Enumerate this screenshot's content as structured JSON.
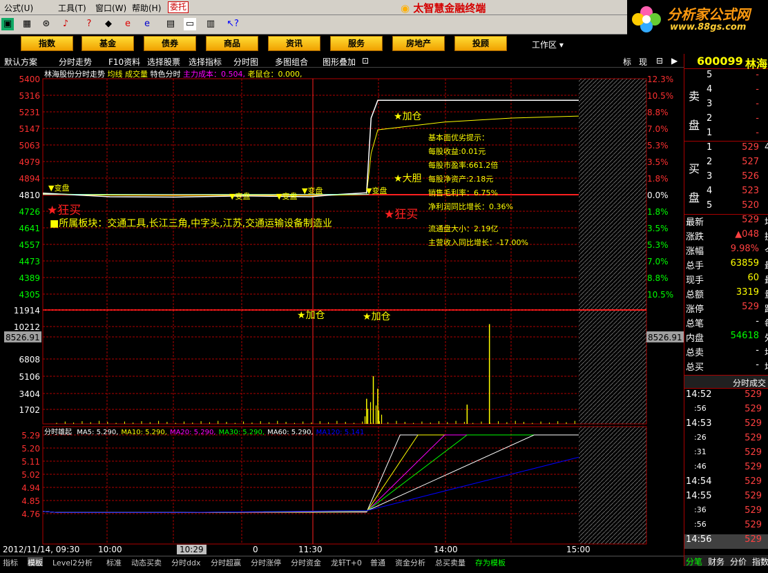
{
  "menu": {
    "items": [
      "公式(U)",
      "工具(T)",
      "窗口(W)",
      "帮助(H)"
    ],
    "entrust": "委托",
    "app_title": "太智慧金融终端"
  },
  "logo": {
    "name": "分析家公式网",
    "url": "www.88gs.com"
  },
  "nav": {
    "buttons": [
      "指数",
      "基金",
      "债券",
      "商品",
      "资讯",
      "服务",
      "房地产",
      "投顾"
    ],
    "workarea": "工作区"
  },
  "subbar": {
    "items": [
      "默认方案",
      "分时走势",
      "F10资料",
      "选择股票",
      "选择指标",
      "分时图",
      "多图组合",
      "图形叠加"
    ],
    "right": [
      "标",
      "现"
    ]
  },
  "stock": {
    "code": "600099",
    "name": "林海"
  },
  "chart_header": {
    "title": "林海股份分时走势",
    "avg": "均线",
    "vol": "成交量",
    "feature": "特色分时",
    "main_cost": "主力成本：0.504,",
    "old_pos": "老鼠仓：0.000,"
  },
  "price_axis": {
    "left": [
      "5400",
      "5316",
      "5231",
      "5147",
      "5063",
      "4979",
      "4894",
      "4810",
      "4726",
      "4641",
      "4557",
      "4473",
      "4389",
      "4305"
    ],
    "right": [
      "12.3%",
      "10.5%",
      "8.8%",
      "7.0%",
      "5.3%",
      "3.5%",
      "1.8%",
      "0.0%",
      "1.8%",
      "3.5%",
      "5.3%",
      "7.0%",
      "8.8%",
      "10.5%"
    ]
  },
  "volume_axis": {
    "left": [
      "11914",
      "10212",
      "8526.91",
      "6808",
      "5106",
      "3404",
      "1702"
    ],
    "cursor_value": "8526.91"
  },
  "annotations": {
    "change": "变盘",
    "add": "加仓",
    "big": "大胆",
    "crazy": "狂买",
    "sector": "所属板块：交通工具,长江三角,中字头,江苏,交通运输设备制造业"
  },
  "fundamentals": {
    "title": "基本面优劣提示：",
    "lines": [
      "每股收益:0.01元",
      "每股市盈率:661.2倍",
      "每股净资产:2.18元",
      "销售毛利率：6.75%",
      "净利润同比增长：0.36%"
    ],
    "lines2": [
      "流通盘大小：2.19亿",
      "主营收入同比增长：-17.00%"
    ]
  },
  "indicator": {
    "name": "分时雄起",
    "ma": [
      {
        "label": "MA5:",
        "value": "5.290,",
        "color": "#ffffff"
      },
      {
        "label": "MA10:",
        "value": "5.290,",
        "color": "#ffff00"
      },
      {
        "label": "MA20:",
        "value": "5.290,",
        "color": "#ff00ff"
      },
      {
        "label": "MA30:",
        "value": "5.290,",
        "color": "#00ff00"
      },
      {
        "label": "MA60:",
        "value": "5.290,",
        "color": "#ffffff"
      },
      {
        "label": "MA120:",
        "value": "5.141",
        "color": "#0000ff"
      }
    ],
    "axis": [
      "5.29",
      "5.20",
      "5.11",
      "5.02",
      "4.94",
      "4.85",
      "4.76"
    ]
  },
  "time_axis": {
    "date": "2012/11/14, 09:30",
    "labels": [
      "10:00",
      "10:29",
      "0",
      "11:30",
      "14:00",
      "15:00"
    ]
  },
  "orderbook": {
    "sell": [
      {
        "n": "5",
        "p": "-",
        "v": ""
      },
      {
        "n": "4",
        "p": "-",
        "v": ""
      },
      {
        "n": "3",
        "p": "-",
        "v": ""
      },
      {
        "n": "2",
        "p": "-",
        "v": ""
      },
      {
        "n": "1",
        "p": "-",
        "v": ""
      }
    ],
    "buy": [
      {
        "n": "1",
        "p": "529",
        "v": "4"
      },
      {
        "n": "2",
        "p": "527",
        "v": ""
      },
      {
        "n": "3",
        "p": "526",
        "v": ""
      },
      {
        "n": "4",
        "p": "523",
        "v": ""
      },
      {
        "n": "5",
        "p": "520",
        "v": ""
      }
    ],
    "sell_label": [
      "卖",
      "盘"
    ],
    "buy_label": [
      "买",
      "盘"
    ]
  },
  "quote": [
    {
      "label": "最新",
      "value": "529",
      "extra": "均",
      "color": "#ff4040"
    },
    {
      "label": "涨跌",
      "value": "▲048",
      "extra": "换",
      "color": "#ff4040"
    },
    {
      "label": "涨幅",
      "value": "9.98%",
      "extra": "今",
      "color": "#ff4040"
    },
    {
      "label": "总手",
      "value": "63859",
      "extra": "最",
      "color": "#ffff00"
    },
    {
      "label": "现手",
      "value": "60",
      "extra": "最",
      "color": "#ffff00"
    },
    {
      "label": "总额",
      "value": "3319",
      "extra": "量",
      "color": "#ffff00"
    },
    {
      "label": "涨停",
      "value": "529",
      "extra": "跌",
      "color": "#ff4040"
    },
    {
      "label": "总笔",
      "value": "-",
      "extra": "每",
      "color": "#ffffff"
    },
    {
      "label": "内盘",
      "value": "54618",
      "extra": "外",
      "color": "#00ff00"
    },
    {
      "label": "总卖",
      "value": "-",
      "extra": "均",
      "color": "#ffffff"
    },
    {
      "label": "总买",
      "value": "-",
      "extra": "均",
      "color": "#ffffff"
    }
  ],
  "ticks_title": "分时成交",
  "ticks": [
    {
      "t": "14:52",
      "p": "529"
    },
    {
      "t": ":56",
      "p": "529"
    },
    {
      "t": "14:53",
      "p": "529"
    },
    {
      "t": ":26",
      "p": "529"
    },
    {
      "t": ":31",
      "p": "529"
    },
    {
      "t": ":46",
      "p": "529"
    },
    {
      "t": "14:54",
      "p": "529"
    },
    {
      "t": "14:55",
      "p": "529"
    },
    {
      "t": ":36",
      "p": "529"
    },
    {
      "t": ":56",
      "p": "529"
    },
    {
      "t": "14:56",
      "p": "529"
    }
  ],
  "bottom_tabs": [
    "指标",
    "模板",
    "Level2分析",
    "标准",
    "动态买卖",
    "分时ddx",
    "分时超赢",
    "分时涨停",
    "分时资金",
    "龙轩T+0",
    "普通",
    "资金分析",
    "总买卖量",
    "存为模板"
  ],
  "right_tabs": [
    "分笔",
    "财务",
    "分价",
    "指数"
  ],
  "chart_data": {
    "type": "line",
    "title": "林海股份分时走势",
    "price_ylim": [
      4305,
      5400
    ],
    "prev_close": 4810,
    "price_x": [
      "09:30",
      "10:00",
      "10:29",
      "11:00",
      "11:30",
      "13:10",
      "13:25",
      "13:27",
      "13:30",
      "14:00",
      "14:30",
      "15:00"
    ],
    "price": [
      4818,
      4800,
      4798,
      4804,
      4800,
      4810,
      4820,
      5200,
      5290,
      5290,
      5290,
      5290
    ],
    "avg": [
      4816,
      4808,
      4806,
      4808,
      4806,
      4808,
      4812,
      5020,
      5140,
      5180,
      5200,
      5210
    ],
    "volume_ylim": [
      0,
      13600
    ],
    "volume_spikes": [
      {
        "x": "13:25",
        "v": 3000
      },
      {
        "x": "13:28",
        "v": 5700
      },
      {
        "x": "13:30",
        "v": 4200
      },
      {
        "x": "14:10",
        "v": 2300
      },
      {
        "x": "14:20",
        "v": 11914
      }
    ]
  }
}
